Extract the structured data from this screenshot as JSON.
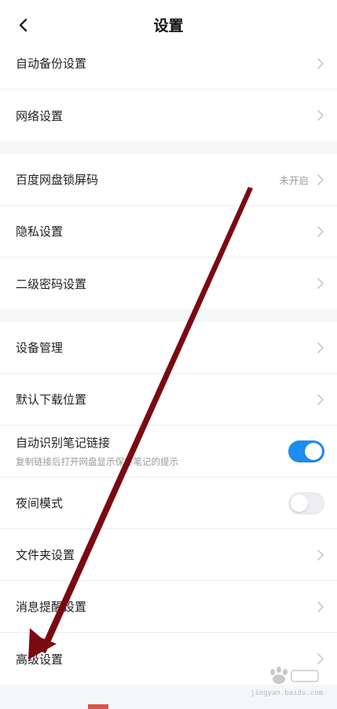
{
  "header": {
    "title": "设置",
    "back_icon": "chevron-left-icon"
  },
  "groups": [
    {
      "items": [
        {
          "label": "自动备份设置",
          "control": "chevron"
        },
        {
          "label": "网络设置",
          "control": "chevron"
        }
      ]
    },
    {
      "items": [
        {
          "label": "百度网盘锁屏码",
          "value": "未开启",
          "control": "chevron"
        },
        {
          "label": "隐私设置",
          "control": "chevron"
        },
        {
          "label": "二级密码设置",
          "control": "chevron"
        }
      ]
    },
    {
      "items": [
        {
          "label": "设备管理",
          "control": "chevron"
        },
        {
          "label": "默认下载位置",
          "control": "chevron"
        },
        {
          "label": "自动识别笔记链接",
          "sublabel": "复制链接后打开网盘显示保存笔记的提示",
          "control": "toggle",
          "toggle_on": true
        },
        {
          "label": "夜间模式",
          "control": "toggle",
          "toggle_on": false
        },
        {
          "label": "文件夹设置",
          "control": "chevron"
        },
        {
          "label": "消息提醒设置",
          "control": "chevron"
        },
        {
          "label": "高级设置",
          "control": "chevron"
        }
      ]
    }
  ],
  "watermark": {
    "text": "jingyan.baidu.com"
  },
  "colors": {
    "accent": "#1d8cf0",
    "arrow": "#7a0a12",
    "background": "#f5f6f8"
  }
}
